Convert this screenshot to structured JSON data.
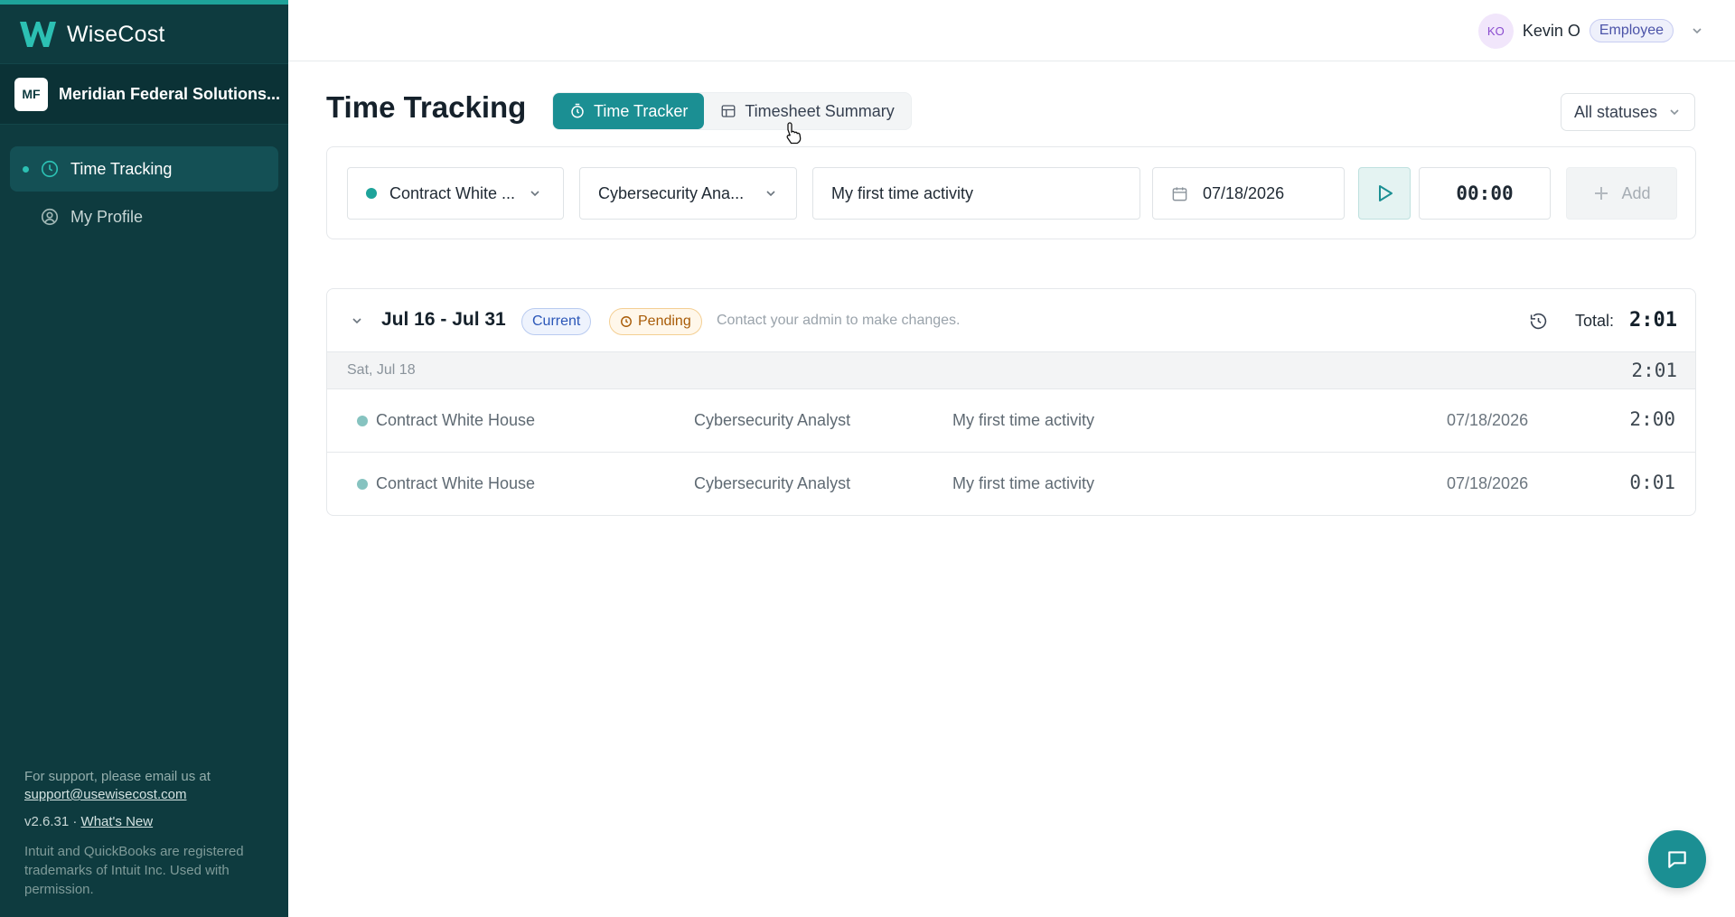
{
  "app": {
    "brand_name": "WiseCost",
    "org_initials": "MF",
    "org_name": "Meridian Federal Solutions..."
  },
  "sidebar": {
    "items": [
      {
        "label": "Time Tracking",
        "icon": "clock-icon",
        "active": true
      },
      {
        "label": "My Profile",
        "icon": "user-circle-icon",
        "active": false
      }
    ],
    "support_text": "For support, please email us at",
    "support_email": "support@usewisecost.com",
    "version": "v2.6.31 ·",
    "whats_new": "What's New",
    "trademark": "Intuit and QuickBooks are registered trademarks of Intuit Inc. Used with permission."
  },
  "topbar": {
    "user_initials": "KO",
    "user_name": "Kevin O",
    "role": "Employee"
  },
  "page": {
    "title": "Time Tracking",
    "tabs": [
      {
        "label": "Time Tracker",
        "icon": "stopwatch-icon",
        "active": true
      },
      {
        "label": "Timesheet Summary",
        "icon": "table-icon",
        "active": false
      }
    ],
    "status_filter": "All statuses"
  },
  "entry_form": {
    "contract": "Contract White ...",
    "role": "Cybersecurity Ana...",
    "description": "My first time activity",
    "date": "07/18/2026",
    "timer": "00:00",
    "add_label": "Add"
  },
  "period": {
    "range": "Jul 16 - Jul 31",
    "current_badge": "Current",
    "status_badge": "Pending",
    "note": "Contact your admin to make changes.",
    "total_label": "Total:",
    "total": "2:01",
    "days": [
      {
        "label": "Sat, Jul 18",
        "total": "2:01",
        "entries": [
          {
            "contract": "Contract White House",
            "role": "Cybersecurity Analyst",
            "description": "My first time activity",
            "date": "07/18/2026",
            "duration": "2:00"
          },
          {
            "contract": "Contract White House",
            "role": "Cybersecurity Analyst",
            "description": "My first time activity",
            "date": "07/18/2026",
            "duration": "0:01"
          }
        ]
      }
    ]
  },
  "colors": {
    "sidebar_bg": "#0e3b3f",
    "accent": "#1b8f93",
    "pending": "#a85b07",
    "current": "#2a56b8"
  }
}
